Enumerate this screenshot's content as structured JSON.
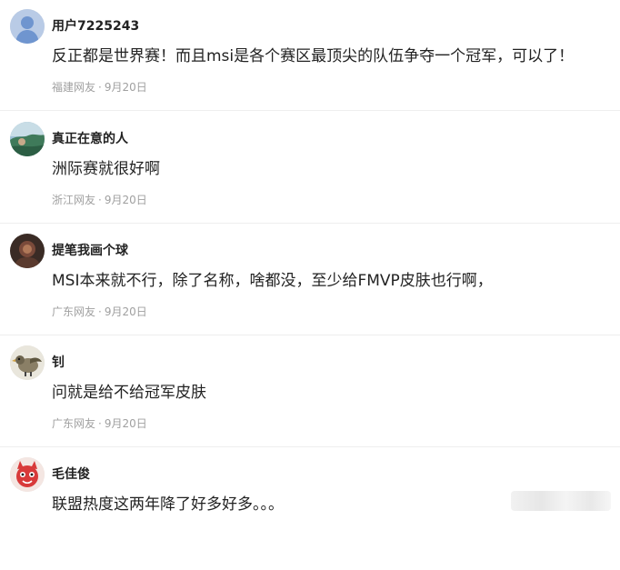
{
  "comments": [
    {
      "username": "用户7225243",
      "content": "反正都是世界赛！而且msi是各个赛区最顶尖的队伍争夺一个冠军，可以了！",
      "location": "福建网友",
      "separator": "·",
      "date": "9月20日",
      "avatar_icon": "default-user-avatar-icon"
    },
    {
      "username": "真正在意的人",
      "content": "洲际赛就很好啊",
      "location": "浙江网友",
      "separator": "·",
      "date": "9月20日",
      "avatar_icon": "landscape-avatar-icon"
    },
    {
      "username": "提笔我画个球",
      "content": "MSI本来就不行，除了名称，啥都没，至少给FMVP皮肤也行啊，",
      "location": "广东网友",
      "separator": "·",
      "date": "9月20日",
      "avatar_icon": "dark-photo-avatar-icon"
    },
    {
      "username": "钊",
      "content": "问就是给不给冠军皮肤",
      "location": "广东网友",
      "separator": "·",
      "date": "9月20日",
      "avatar_icon": "bird-avatar-icon"
    },
    {
      "username": "毛佳俊",
      "content": "联盟热度这两年降了好多好多。。。",
      "location": "",
      "separator": "",
      "date": "",
      "avatar_icon": "red-cartoon-avatar-icon"
    }
  ],
  "colors": {
    "text_primary": "#222222",
    "text_meta": "#a0a0a0",
    "divider": "#eeeeee",
    "default_avatar_bg": "#b9cbe6",
    "default_avatar_fg": "#6f95cf"
  }
}
